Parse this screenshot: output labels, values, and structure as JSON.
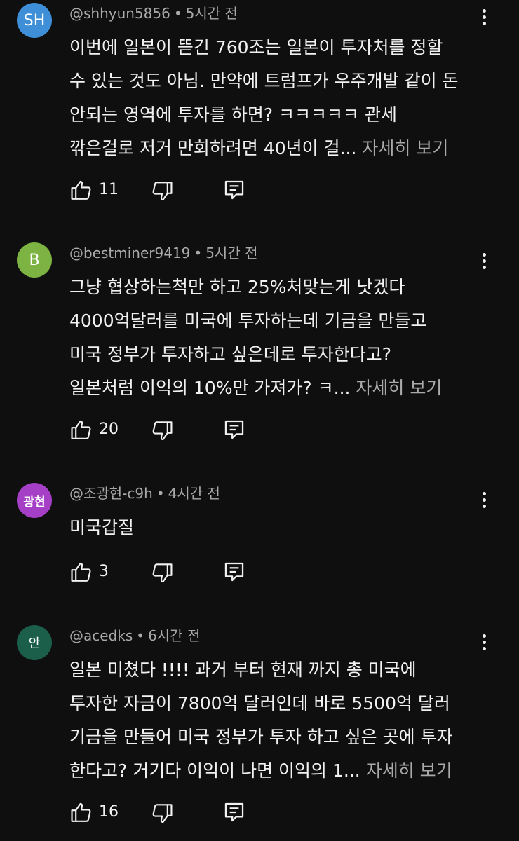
{
  "comments": [
    {
      "avatar": {
        "text": "SH",
        "color": "#3f8fd8"
      },
      "handle": "@shhyun5856",
      "time": "5시간 전",
      "lines": [
        "이번에 일본이 뜯긴 760조는 일본이 투자처를 정할",
        "수 있는 것도 아님. 만약에 트럼프가 우주개발 같이 돈",
        "안되는 영역에 투자를 하면? ㅋㅋㅋㅋㅋ 관세",
        "깎은걸로 저거 만회하려면 40년이 걸..."
      ],
      "more": "자세히 보기",
      "likes": "11"
    },
    {
      "avatar": {
        "text": "B",
        "color": "#7cb342"
      },
      "handle": "@bestminer9419",
      "time": "5시간 전",
      "lines": [
        "그냥 협상하는척만 하고 25%처맞는게 낫겠다",
        "4000억달러를 미국에 투자하는데 기금을 만들고",
        "미국 정부가 투자하고 싶은데로 투자한다고?",
        "일본처럼 이익의 10%만 가져가? ㅋ..."
      ],
      "more": "자세히 보기",
      "likes": "20"
    },
    {
      "avatar": {
        "text": "광현",
        "color": "#a43fc6"
      },
      "handle": "@조광현-c9h",
      "time": "4시간 전",
      "lines": [
        "미국갑질"
      ],
      "more": "",
      "likes": "3"
    },
    {
      "avatar": {
        "text": "안",
        "color": "#1b5e4a"
      },
      "handle": "@acedks",
      "time": "6시간 전",
      "lines": [
        "일본 미쳤다 !!!! 과거 부터 현재 까지 총 미국에",
        "투자한 자금이 7800억 달러인데 바로 5500억 달러",
        "기금을 만들어 미국 정부가 투자 하고 싶은 곳에 투자",
        "한다고? 거기다 이익이 나면 이익의 1..."
      ],
      "more": "자세히 보기",
      "likes": "16"
    }
  ],
  "icons": {
    "like": "thumbs-up-icon",
    "dislike": "thumbs-down-icon",
    "reply": "reply-icon",
    "more": "more-vert-icon"
  }
}
